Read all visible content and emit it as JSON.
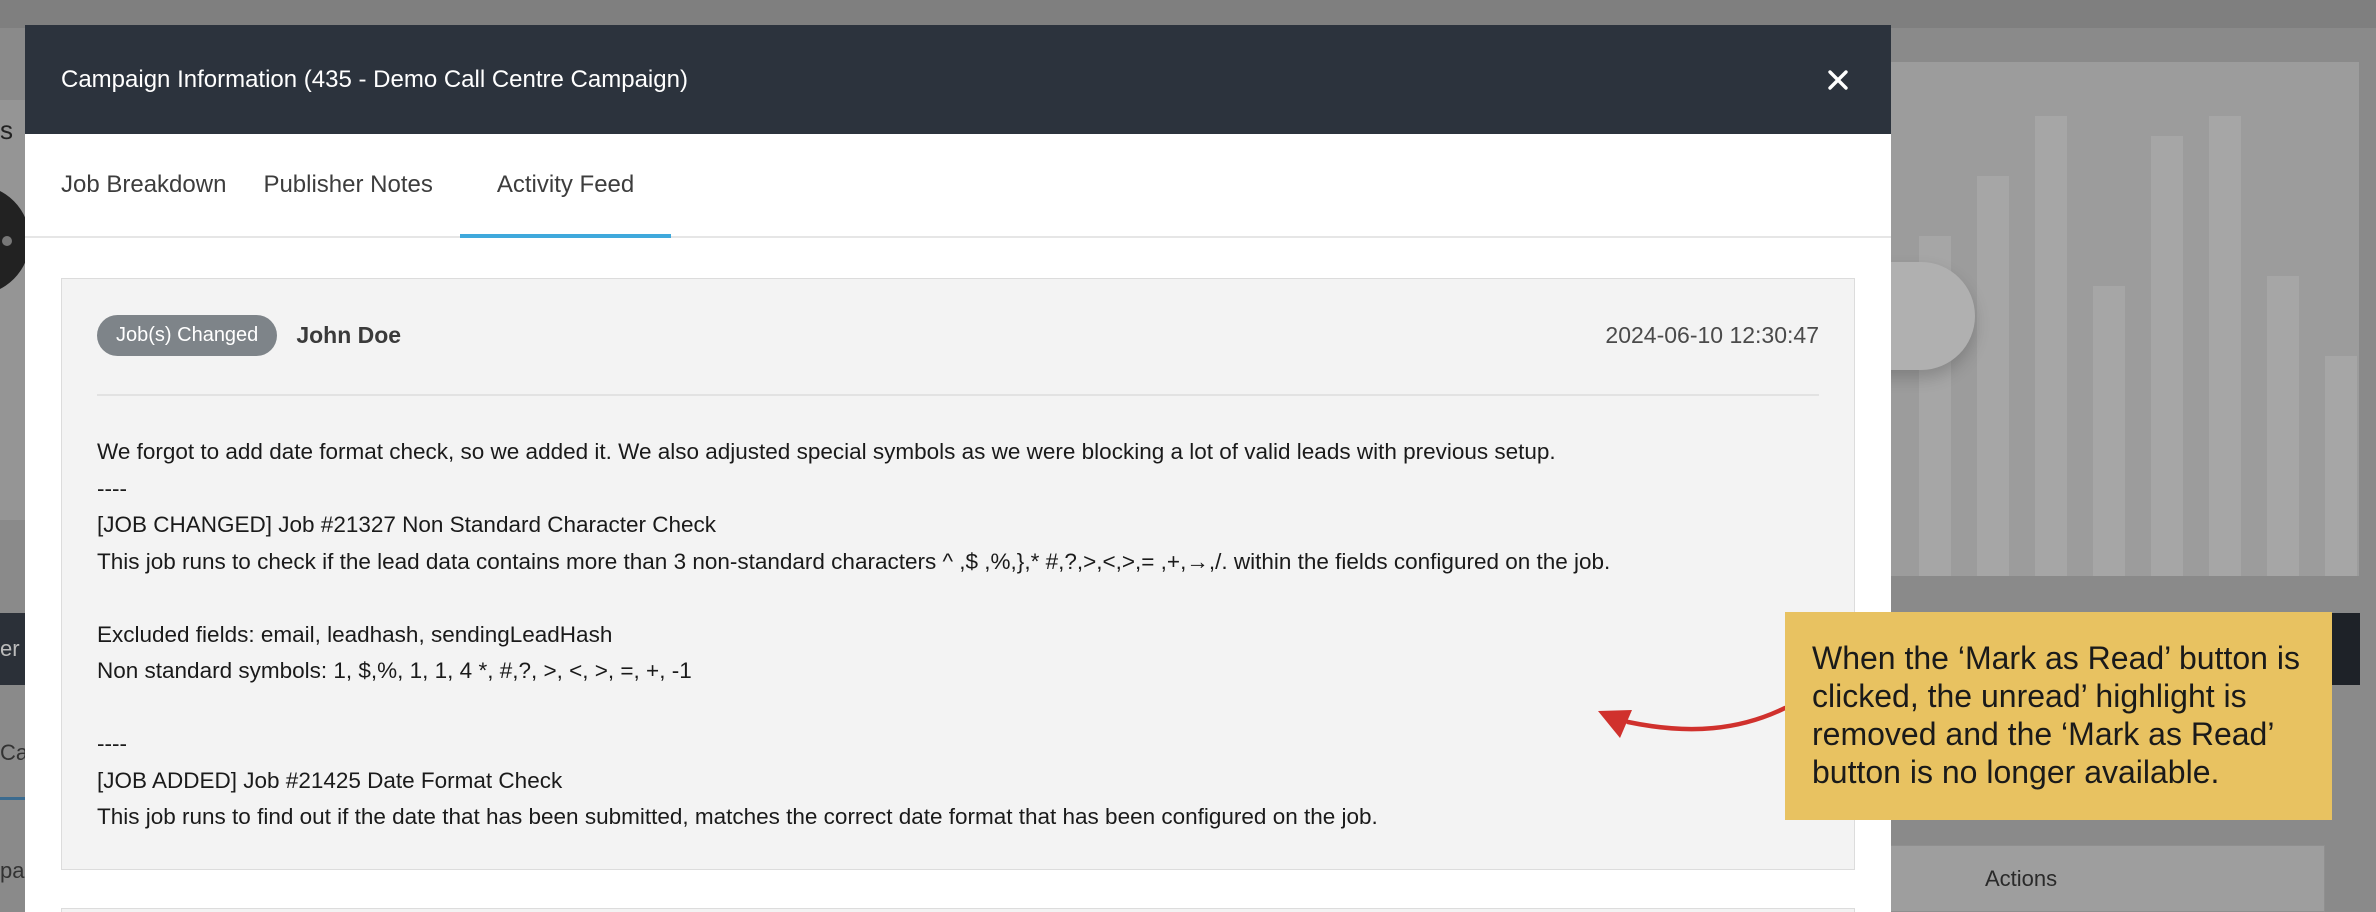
{
  "background": {
    "left_letter": "s",
    "left_dark_text": "er C",
    "left_tab_text": "Car",
    "left_bottom_text": "pa",
    "actions_label": "Actions"
  },
  "modal": {
    "title": "Campaign Information (435 - Demo Call Centre Campaign)",
    "close_icon": "close-x-icon",
    "tabs": [
      {
        "label": "Job Breakdown",
        "active": false
      },
      {
        "label": "Publisher Notes",
        "active": false
      },
      {
        "label": "Activity Feed",
        "active": true
      }
    ],
    "accent_color": "#3fa9dc",
    "header_color": "#2c333d"
  },
  "feed": {
    "entry": {
      "badge": "Job(s) Changed",
      "author": "John Doe",
      "timestamp": "2024-06-10 12:30:47",
      "lines": [
        "We forgot to add date format check, so we added it. We also adjusted special symbols as we were blocking a lot of valid leads with previous setup.",
        "----",
        "[JOB CHANGED] Job #21327 Non Standard Character Check",
        "This job runs to check if the lead data contains more than 3 non-standard characters ^ ,$ ,%,},* #,?,>,<,>,= ,+,→,/. within the fields configured on the job.",
        "",
        "Excluded fields: email, leadhash, sendingLeadHash",
        "Non standard symbols: 1, $,%, 1, 1, 4 *, #,?, >, <, >, =, +, -1",
        "",
        "----",
        "[JOB ADDED] Job #21425 Date Format Check",
        "This job runs to find out if the date that has been submitted, matches the correct date format that has been configured on the job."
      ]
    }
  },
  "callout": {
    "text": "When the ‘Mark as Read’ button is clicked, the unread’ highlight is removed and the ‘Mark as Read’ button is no longer available.",
    "color": "#e8c261",
    "arrow_color": "#d0312d"
  }
}
